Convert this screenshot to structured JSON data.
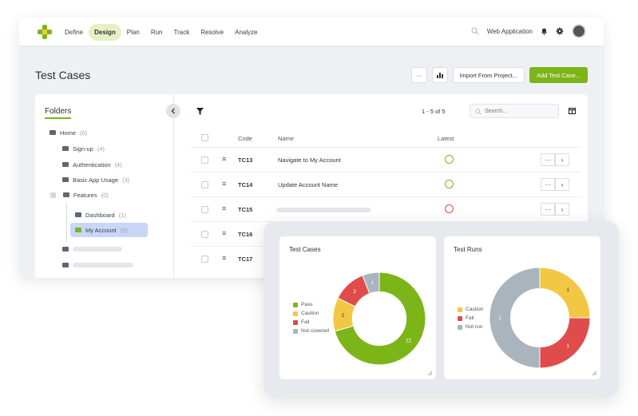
{
  "nav": {
    "items": [
      "Define",
      "Design",
      "Plan",
      "Run",
      "Track",
      "Resolve",
      "Analyze"
    ],
    "active": "Design",
    "project": "Web Application"
  },
  "page": {
    "title": "Test Cases",
    "more_label": "···",
    "import_label": "Import From Project...",
    "add_label": "Add Test Case..."
  },
  "folders": {
    "title": "Folders",
    "items": [
      {
        "label": "Home",
        "count": "(0)"
      },
      {
        "label": "Sign-up",
        "count": "(4)"
      },
      {
        "label": "Authentication",
        "count": "(4)"
      },
      {
        "label": "Basic App Usage",
        "count": "(3)"
      },
      {
        "label": "Features",
        "count": "(0)"
      },
      {
        "label": "Dashboard",
        "count": "(1)"
      },
      {
        "label": "My Account",
        "count": "(5)"
      }
    ]
  },
  "table": {
    "pagination": "1 - 5 of 5",
    "search_placeholder": "Search...",
    "headers": {
      "code": "Code",
      "name": "Name",
      "latest": "Latest"
    },
    "rows": [
      {
        "code": "TC13",
        "name": "Navigate to My Account",
        "status": "pass"
      },
      {
        "code": "TC14",
        "name": "Update Account Name",
        "status": "pass"
      },
      {
        "code": "TC15",
        "name": "",
        "status": "fail"
      },
      {
        "code": "TC16",
        "name": "",
        "status": ""
      },
      {
        "code": "TC17",
        "name": "",
        "status": ""
      }
    ]
  },
  "charts": {
    "colors": {
      "pass": "#7cb518",
      "caution": "#f2c744",
      "fail": "#e04c4c",
      "not_covered": "#aab4bd"
    }
  },
  "chart_data": [
    {
      "type": "pie",
      "title": "Test Cases",
      "categories": [
        "Pass",
        "Caution",
        "Fail",
        "Not covered"
      ],
      "values": [
        12,
        2,
        2,
        1
      ],
      "labels": [
        "12",
        "2",
        "2",
        "1"
      ]
    },
    {
      "type": "pie",
      "title": "Test Runs",
      "categories": [
        "Caution",
        "Fail",
        "Not run"
      ],
      "values": [
        1,
        1,
        2
      ],
      "labels": [
        "1",
        "1",
        "2"
      ]
    }
  ]
}
